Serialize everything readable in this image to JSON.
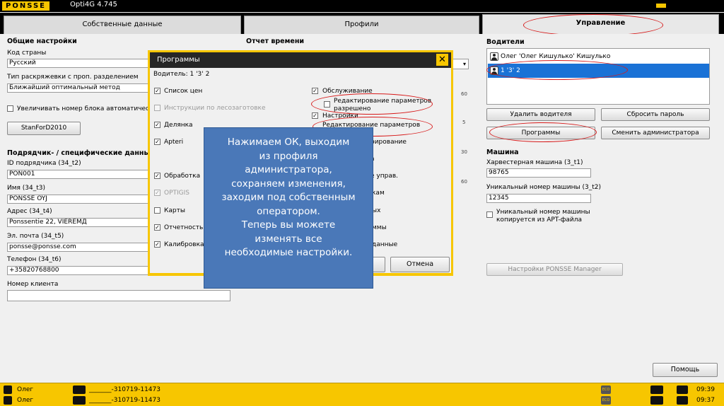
{
  "app": {
    "logo": "PONSSE",
    "version": "Opti4G 4.745"
  },
  "tabs": [
    {
      "label": "Собственные данные"
    },
    {
      "label": "Профили"
    },
    {
      "label": "Управление"
    }
  ],
  "general": {
    "title": "Общие настройки",
    "country_label": "Код страны",
    "country_value": "Русский",
    "coloring_label": "Тип раскряжевки с проп. разделением",
    "coloring_value": "Ближайший оптимальный метод",
    "increase_block_label": "Увеличивать номер блока автоматически",
    "stanford_button": "StanForD2010"
  },
  "contractor": {
    "title": "Подрядчик- / специфические данные ха",
    "id_label": "ID подрядчика (34_t2)",
    "id_value": "PON001",
    "name_label": "Имя (34_t3)",
    "name_value": "PONSSE OYJ",
    "address_label": "Адрес (34_t4)",
    "address_value": "Ponssentie 22, VIEREMД",
    "email_label": "Эл. почта (34_t5)",
    "email_value": "ponsse@ponsse.com",
    "phone_label": "Телефон (34_t6)",
    "phone_value": "+35820768800",
    "client_label": "Номер клиента",
    "client_value": ""
  },
  "time_report": {
    "title": "Отчет времени"
  },
  "ruler_ticks": [
    "60",
    "5",
    "30",
    "60"
  ],
  "drivers": {
    "title": "Водители",
    "items": [
      {
        "label": "Олег 'Олег Кишулько' Кишулько"
      },
      {
        "label": "1 '3' 2"
      }
    ],
    "delete_button": "Удалить водителя",
    "reset_password_button": "Сбросить пароль",
    "programs_button": "Программы",
    "change_admin_button": "Сменить администратора"
  },
  "machine": {
    "title": "Машина",
    "harvester_label": "Харвестерная машина (3_t1)",
    "harvester_value": "98765",
    "unique_label": "Уникальный номер машины (3_t2)",
    "unique_value": "12345",
    "copy_label_1": "Уникальный номер машины",
    "copy_label_2": "копируется из APT-файла",
    "manager_button": "Настройки PONSSE Manager"
  },
  "dialog": {
    "title": "Программы",
    "close_glyph": "✕",
    "driver_text": "Водитель: 1 '3' 2",
    "left_items": [
      {
        "label": "Список цен",
        "checked": true,
        "enabled": true
      },
      {
        "label": "Инструкции по лесозаготовке",
        "checked": false,
        "enabled": false
      },
      {
        "label": "Делянка",
        "checked": true,
        "enabled": true
      },
      {
        "label": "Apteri",
        "checked": true,
        "enabled": true
      },
      {
        "label": "Обработка",
        "checked": true,
        "enabled": true
      },
      {
        "label": "OPTIGIS",
        "checked": true,
        "enabled": false
      },
      {
        "label": "Карты",
        "checked": false,
        "enabled": true
      },
      {
        "label": "Отчетность",
        "checked": true,
        "enabled": true
      },
      {
        "label": "Калибровка",
        "checked": true,
        "enabled": true
      }
    ],
    "right_items": [
      {
        "label": "Обслуживание"
      },
      {
        "label": "Редактирование параметров"
      },
      {
        "label": "разрешено"
      },
      {
        "label": "Настройки"
      },
      {
        "label": "Редактирование параметров"
      },
      {
        "label": "рирование"
      },
      {
        "label": "а"
      },
      {
        "label": "е управ."
      },
      {
        "label": "кам"
      },
      {
        "label": "ых"
      },
      {
        "label": "ммы"
      },
      {
        "label": "данные"
      }
    ],
    "cancel_button": "Отмена"
  },
  "note": {
    "lines": [
      "Нажимаем ОК, выходим",
      "из профиля",
      "администратора,",
      "сохраняем изменения,",
      "заходим под собственным",
      "оператором.",
      "Теперь вы можете",
      "изменять все",
      "необходимые настройки."
    ]
  },
  "help_button": "Помощь",
  "status": {
    "user_1": "Олег",
    "user_2": "Олег",
    "code_1": "_______-310719-11473",
    "code_2": "_______-310719-11473",
    "time_1": "09:39",
    "time_2": "09:37",
    "eco_1": "ECO",
    "eco_2": "ECO"
  },
  "colors": {
    "brand_yellow": "#f7c600",
    "selection_blue": "#1a72d6",
    "annotation_red": "#d71a1a",
    "note_blue": "#4a78b8"
  }
}
